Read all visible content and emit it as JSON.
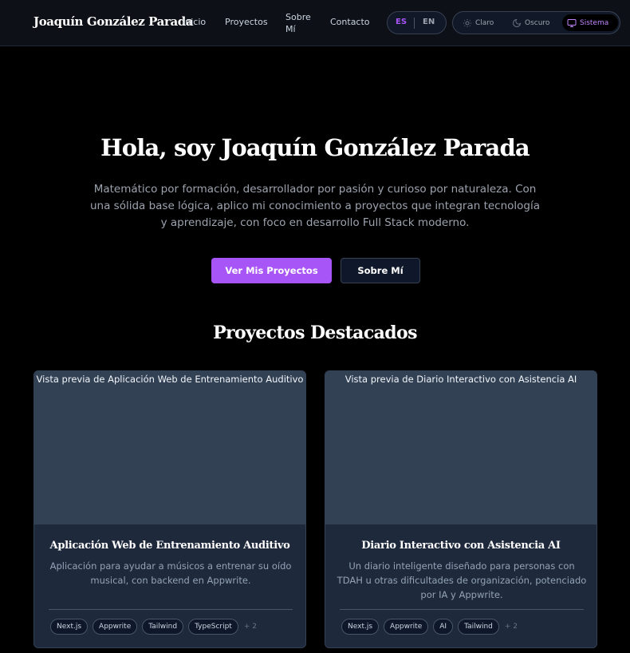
{
  "header": {
    "brand": "Joaquín González Parada",
    "nav": {
      "inicio": "Inicio",
      "proyectos": "Proyectos",
      "sobre_mi": "Sobre Mí",
      "contacto": "Contacto"
    },
    "language": {
      "es": "ES",
      "en": "EN",
      "active": "ES"
    },
    "theme": {
      "light": "Claro",
      "dark": "Oscuro",
      "system": "Sistema",
      "active": "Sistema"
    }
  },
  "hero": {
    "title": "Hola, soy Joaquín González Parada",
    "subtitle": "Matemático por formación, desarrollador por pasión y curioso por naturaleza. Con una sólida base lógica, aplico mi conocimiento a proyectos que integran tecnología y aprendizaje, con foco en desarrollo Full Stack moderno.",
    "primary_button": "Ver Mis Proyectos",
    "secondary_button": "Sobre Mí"
  },
  "featured": {
    "title": "Proyectos Destacados",
    "projects": [
      {
        "image_alt": "Vista previa de Aplicación Web de Entrenamiento Auditivo",
        "title": "Aplicación Web de Entrenamiento Auditivo",
        "description": "Aplicación para ayudar a músicos a entrenar su oído musical, con backend en Appwrite.",
        "tags": [
          "Next.js",
          "Appwrite",
          "Tailwind",
          "TypeScript"
        ],
        "more": "+ 2"
      },
      {
        "image_alt": "Vista previa de Diario Interactivo con Asistencia AI",
        "title": "Diario Interactivo con Asistencia AI",
        "description": "Un diario inteligente diseñado para personas con TDAH u otras dificultades de organización, potenciado por IA y Appwrite.",
        "tags": [
          "Next.js",
          "Appwrite",
          "AI",
          "Tailwind"
        ],
        "more": "+ 2"
      }
    ]
  },
  "colors": {
    "accent": "#a855f7",
    "background": "#000000",
    "header_bg": "#0d1117",
    "card_bg": "#1e293b"
  },
  "icons": [
    "sun-icon",
    "moon-icon",
    "monitor-icon"
  ]
}
